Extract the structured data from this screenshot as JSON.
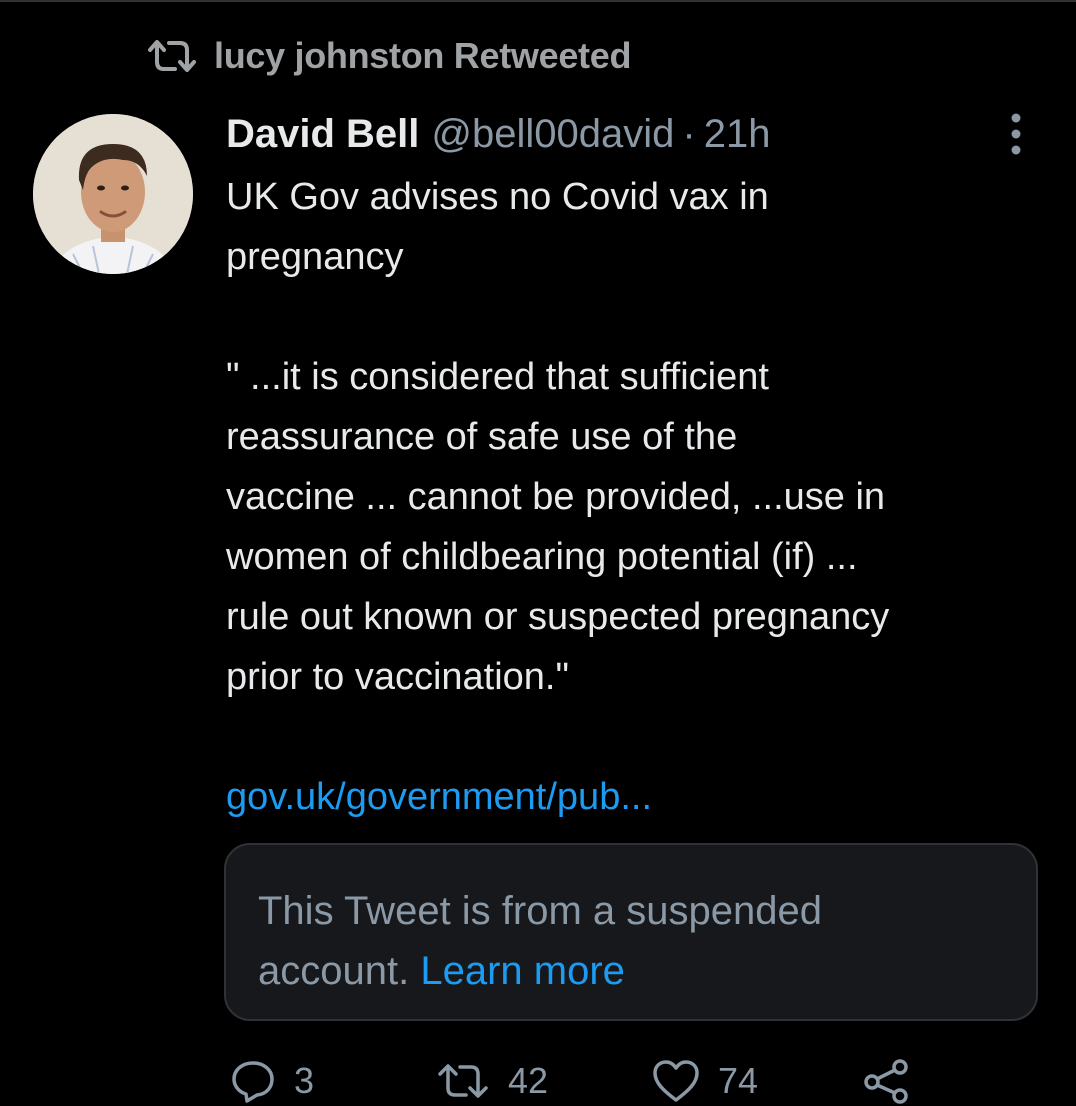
{
  "retweet_context": {
    "label": "lucy johnston Retweeted",
    "icon": "retweet-icon"
  },
  "tweet": {
    "author_name": "David Bell",
    "handle": "@bell00david",
    "separator": "·",
    "timestamp": "21h",
    "avatar_icon": "avatar-photo",
    "more_icon": "more-options-icon",
    "body_lines": [
      "UK Gov advises no Covid vax in",
      "pregnancy",
      "",
      "\" ...it is considered that sufficient",
      "reassurance of safe use of the",
      "vaccine ... cannot be provided, ...use in",
      "women of childbearing potential (if) ...",
      "rule out known or suspected pregnancy",
      "prior to vaccination.\""
    ],
    "link": "gov.uk/government/pub..."
  },
  "quoted": {
    "line1": "This Tweet is from a suspended",
    "line2_prefix": "account.",
    "learn_more": "Learn more"
  },
  "actions": {
    "reply_count": "3",
    "retweet_count": "42",
    "like_count": "74",
    "reply_icon": "reply-icon",
    "retweet_icon": "retweet-icon",
    "like_icon": "heart-icon",
    "share_icon": "share-icon"
  },
  "colors": {
    "background": "#000000",
    "text_primary": "#e7e9ea",
    "text_secondary": "#8b98a5",
    "link": "#1d9bf0",
    "card_background": "#16181c",
    "border": "#2f3336"
  }
}
